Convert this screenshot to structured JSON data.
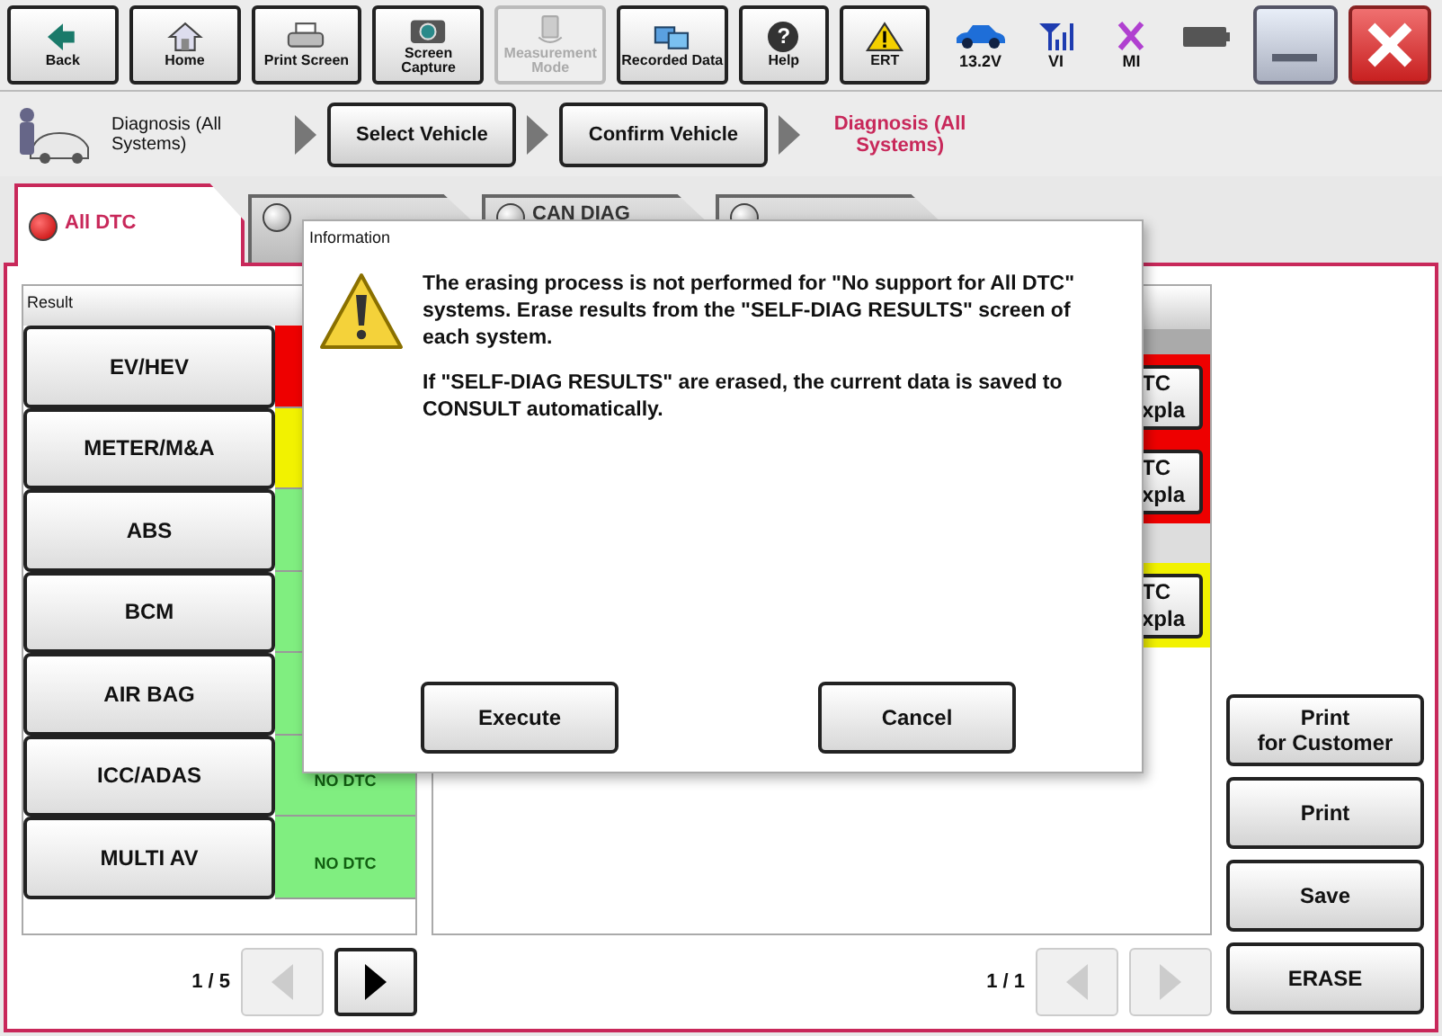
{
  "toolbar": [
    {
      "label": "Back",
      "disabled": false
    },
    {
      "label": "Home",
      "disabled": false
    },
    {
      "label": "Print Screen",
      "disabled": false
    },
    {
      "label": "Screen Capture",
      "disabled": false
    },
    {
      "label": "Measurement Mode",
      "disabled": true
    },
    {
      "label": "Recorded Data",
      "disabled": false
    },
    {
      "label": "Help",
      "disabled": false,
      "glyph": "?"
    },
    {
      "label": "ERT",
      "disabled": false
    }
  ],
  "indicators": [
    {
      "kind": "car",
      "label": "13.2V"
    },
    {
      "kind": "signal",
      "label": "VI"
    },
    {
      "kind": "cross",
      "label": "MI"
    },
    {
      "kind": "battery"
    }
  ],
  "breadcrumb": [
    {
      "kind": "start",
      "label": "Diagnosis (All Systems)"
    },
    {
      "kind": "button",
      "label": "Select Vehicle"
    },
    {
      "kind": "button",
      "label": "Confirm Vehicle"
    },
    {
      "kind": "current",
      "label": "Diagnosis (All Systems)"
    }
  ],
  "tabs": [
    {
      "label": "All DTC",
      "selected": true
    },
    {
      "selected": false
    },
    {
      "label": "CAN DIAG",
      "selected": false
    },
    {
      "selected": false
    }
  ],
  "result_list": {
    "header": "Result",
    "rows": [
      {
        "label": "EV/HEV",
        "color": "#ee0000"
      },
      {
        "label": "METER/M&A",
        "color": "#f2f200"
      },
      {
        "label": "ABS",
        "color": "#80ee80"
      },
      {
        "label": "BCM",
        "color": "#80ee80"
      },
      {
        "label": "AIR BAG",
        "color": "#80ee80"
      },
      {
        "label": "ICC/ADAS",
        "color": "#80ee80",
        "status": "NO DTC"
      },
      {
        "label": "MULTI AV",
        "color": "#80ee80",
        "status": "NO DTC"
      }
    ],
    "pager": {
      "page": "1 / 5",
      "prev_disabled": true,
      "next_disabled": false
    }
  },
  "dtc_list": {
    "rows": [
      {
        "kind": "dtc",
        "color": "#ee0000",
        "lines": [
          "TC",
          "xpla"
        ]
      },
      {
        "kind": "dtc",
        "color": "#ee0000",
        "lines": [
          "TC",
          "xpla"
        ]
      },
      {
        "kind": "gap"
      },
      {
        "kind": "dtc",
        "color": "#f2f200",
        "lines": [
          "TC",
          "xpla"
        ]
      }
    ],
    "pager": {
      "page": "1 / 1",
      "prev_disabled": true,
      "next_disabled": true
    }
  },
  "actions": [
    "Print\nfor Customer",
    "Print",
    "Save",
    "ERASE"
  ],
  "dialog": {
    "title": "Information",
    "paragraphs": [
      "The erasing process is not performed for \"No support for All DTC\" systems. Erase results from the \"SELF-DIAG RESULTS\" screen of each system.",
      "If \"SELF-DIAG RESULTS\" are erased, the current data is saved to CONSULT automatically."
    ],
    "buttons": [
      "Execute",
      "Cancel"
    ]
  }
}
